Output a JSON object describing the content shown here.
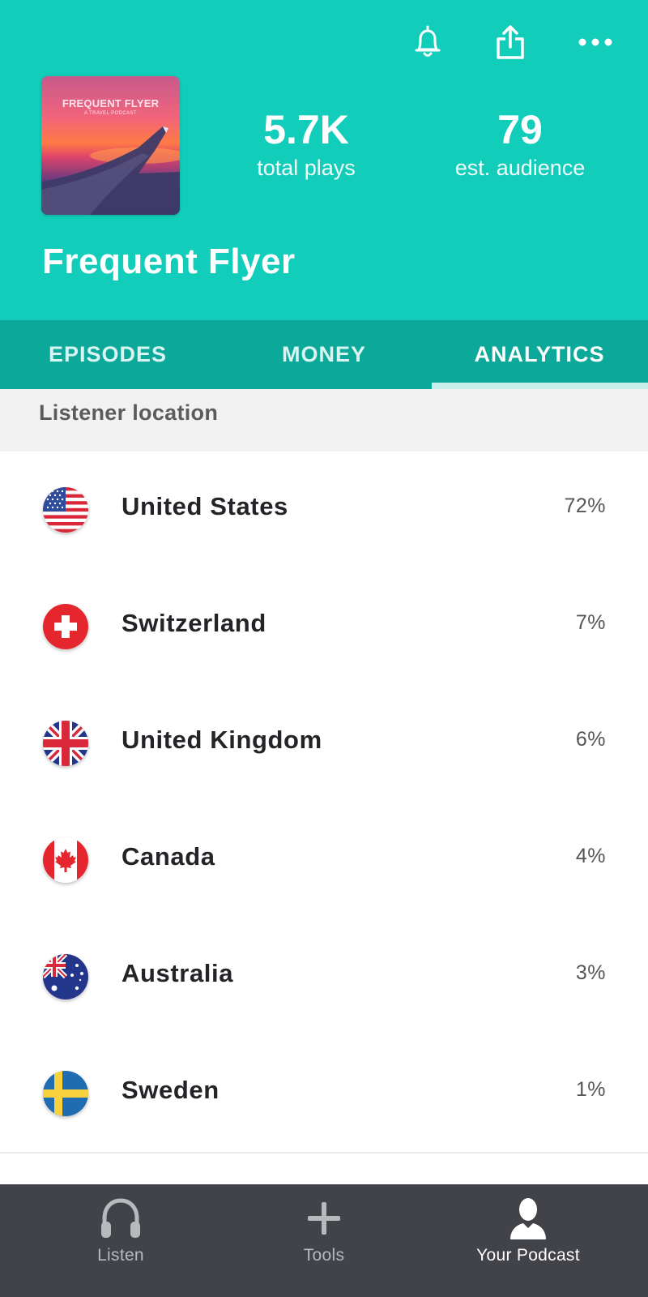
{
  "header": {
    "icons": [
      "bell-icon",
      "share-icon",
      "more-icon"
    ],
    "cover": {
      "title": "FREQUENT FLYER",
      "subtitle": "A TRAVEL PODCAST"
    },
    "stats": [
      {
        "value": "5.7K",
        "label": "total plays"
      },
      {
        "value": "79",
        "label": "est. audience"
      }
    ],
    "podcast_title": "Frequent Flyer",
    "background_color": "#12cdb9"
  },
  "tabs": [
    {
      "label": "EPISODES",
      "active": false
    },
    {
      "label": "MONEY",
      "active": false
    },
    {
      "label": "ANALYTICS",
      "active": true
    }
  ],
  "section": {
    "title": "Listener location"
  },
  "locations": [
    {
      "country": "United States",
      "percent": "72%",
      "flag_icon": "us-flag-icon"
    },
    {
      "country": "Switzerland",
      "percent": "7%",
      "flag_icon": "switzerland-flag-icon"
    },
    {
      "country": "United Kingdom",
      "percent": "6%",
      "flag_icon": "uk-flag-icon"
    },
    {
      "country": "Canada",
      "percent": "4%",
      "flag_icon": "canada-flag-icon"
    },
    {
      "country": "Australia",
      "percent": "3%",
      "flag_icon": "australia-flag-icon"
    },
    {
      "country": "Sweden",
      "percent": "1%",
      "flag_icon": "sweden-flag-icon"
    }
  ],
  "bottom_nav": [
    {
      "label": "Listen",
      "icon": "headphones-icon",
      "active": false
    },
    {
      "label": "Tools",
      "icon": "plus-icon",
      "active": false
    },
    {
      "label": "Your Podcast",
      "icon": "person-icon",
      "active": true
    }
  ]
}
